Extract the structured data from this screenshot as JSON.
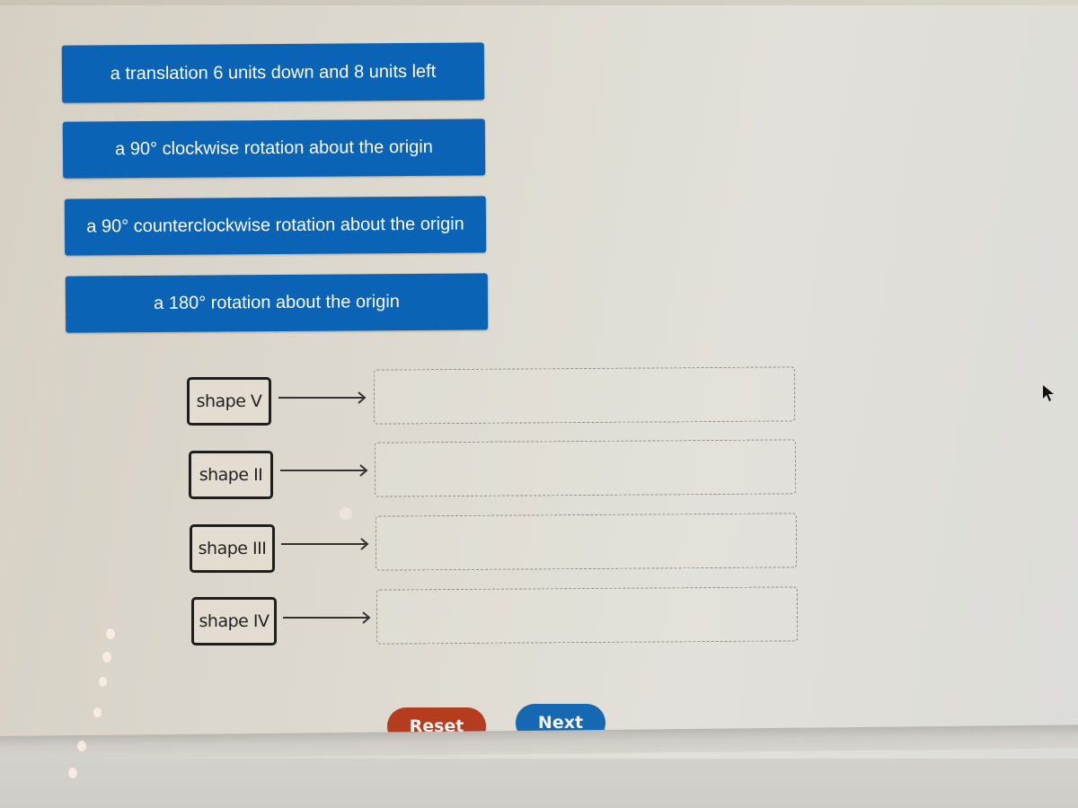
{
  "options": [
    {
      "label": "a translation 6 units down and 8 units left"
    },
    {
      "label": "a 90° clockwise rotation about the origin"
    },
    {
      "label": "a 90° counterclockwise rotation about the origin"
    },
    {
      "label": "a 180° rotation about the origin"
    }
  ],
  "matching": [
    {
      "shape": "shape V",
      "answer": ""
    },
    {
      "shape": "shape II",
      "answer": ""
    },
    {
      "shape": "shape III",
      "answer": ""
    },
    {
      "shape": "shape IV",
      "answer": ""
    }
  ],
  "buttons": {
    "reset_label": "Reset",
    "next_label": "Next"
  },
  "colors": {
    "tile_blue": "#0b63b6",
    "reset_red": "#b33d1e",
    "next_blue": "#1668b3"
  },
  "icons": {
    "arrow": "right-arrow-icon",
    "cursor": "mouse-pointer-icon"
  }
}
